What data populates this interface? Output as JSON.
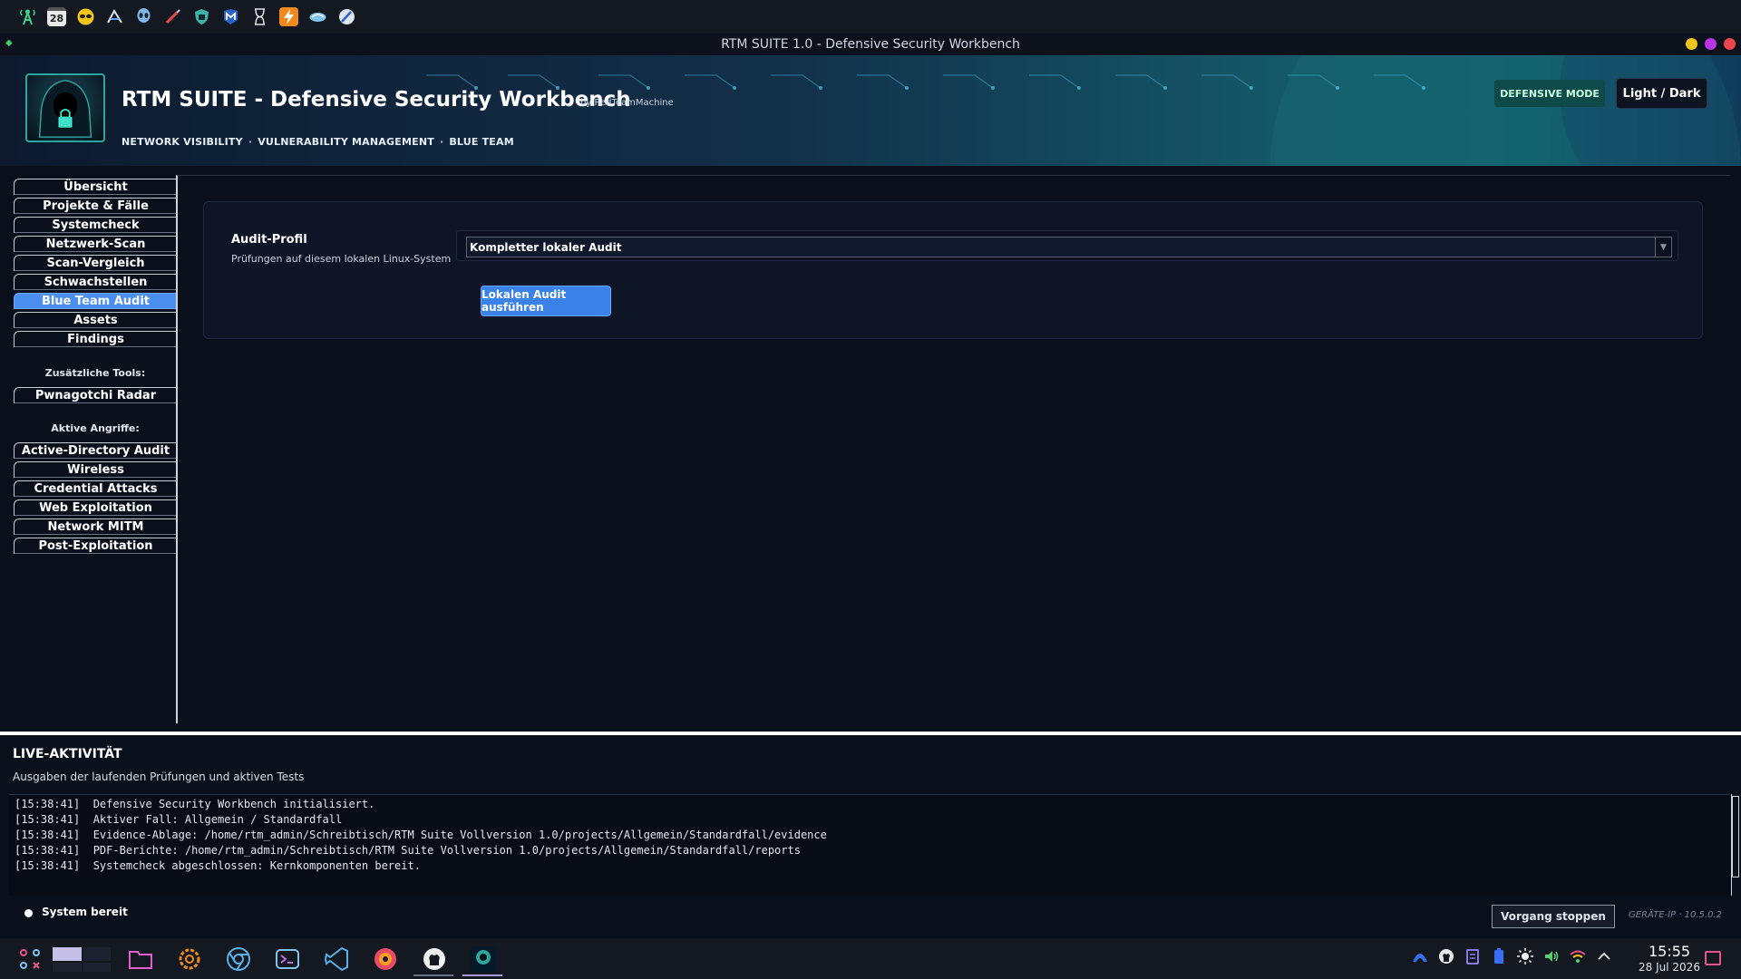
{
  "window": {
    "title": "RTM SUITE 1.0 - Defensive Security Workbench",
    "control_colors": [
      "#f5c518",
      "#b936e8",
      "#f0444c"
    ]
  },
  "top_panel": {
    "icons": [
      "antenna-icon",
      "calendar-icon",
      "alien-face-icon",
      "burpsuite-icon",
      "alien-head-icon",
      "syringe-icon",
      "shield-icon",
      "metasploit-icon",
      "hourglass-icon",
      "lightning-icon",
      "wireshark-fin-icon",
      "globe-wrench-icon"
    ],
    "calendar_day": "28"
  },
  "header": {
    "title": "RTM SUITE - Defensive Security Workbench",
    "by_line": "by RedTeamMachine",
    "subtitle_items": [
      "NETWORK VISIBILITY",
      "VULNERABILITY MANAGEMENT",
      "BLUE TEAM"
    ],
    "subtitle_sep": "·",
    "mode_badge": "DEFENSIVE MODE",
    "theme_toggle": "Light / Dark",
    "accent_color": "#145a6a"
  },
  "sidebar": {
    "items": [
      "Übersicht",
      "Projekte & Fälle",
      "Systemcheck",
      "Netzwerk-Scan",
      "Scan-Vergleich",
      "Schwachstellen",
      "Blue Team Audit",
      "Assets",
      "Findings"
    ],
    "active_item": "Blue Team Audit",
    "tools_heading": "Zusätzliche Tools:",
    "tools_items": [
      "Pwnagotchi Radar"
    ],
    "attacks_heading": "Aktive Angriffe:",
    "attacks_items": [
      "Active-Directory Audit",
      "Wireless",
      "Credential Attacks",
      "Web Exploitation",
      "Network MITM",
      "Post-Exploitation"
    ],
    "active_color": "#4b8ff0"
  },
  "audit": {
    "label": "Audit-Profil",
    "description": "Prüfungen auf diesem lokalen Linux-System",
    "selected_profile": "Kompletter lokaler Audit",
    "run_button": "Lokalen Audit ausführen",
    "button_color": "#3b82e8"
  },
  "live": {
    "title": "LIVE-AKTIVITÄT",
    "description": "Ausgaben der laufenden Prüfungen und aktiven Tests",
    "log": [
      "[15:38:41]  Defensive Security Workbench initialisiert.",
      "[15:38:41]  Aktiver Fall: Allgemein / Standardfall",
      "[15:38:41]  Evidence-Ablage: /home/rtm_admin/Schreibtisch/RTM Suite Vollversion 1.0/projects/Allgemein/Standardfall/evidence",
      "[15:38:41]  PDF-Berichte: /home/rtm_admin/Schreibtisch/RTM Suite Vollversion 1.0/projects/Allgemein/Standardfall/reports",
      "[15:38:41]  Systemcheck abgeschlossen: Kernkomponenten bereit."
    ]
  },
  "status": {
    "text": "System bereit",
    "stop_button": "Vorgang stoppen",
    "device_ip": "GERÄTE-IP · 10.5.0.2"
  },
  "taskbar": {
    "apps": [
      "app-launcher-icon",
      "desktop-pager-icon",
      "file-manager-icon",
      "settings-icon",
      "chrome-icon",
      "terminal-icon",
      "vscode-icon",
      "firefox-icon",
      "github-desktop-icon",
      "rtm-suite-icon"
    ],
    "tray_icons": [
      "vpn-icon",
      "github-icon",
      "clipboard-icon",
      "battery-icon",
      "brightness-icon",
      "volume-icon",
      "wifi-icon",
      "chevron-up-icon"
    ],
    "time": "15:55",
    "date": "28 Jul 2026"
  }
}
